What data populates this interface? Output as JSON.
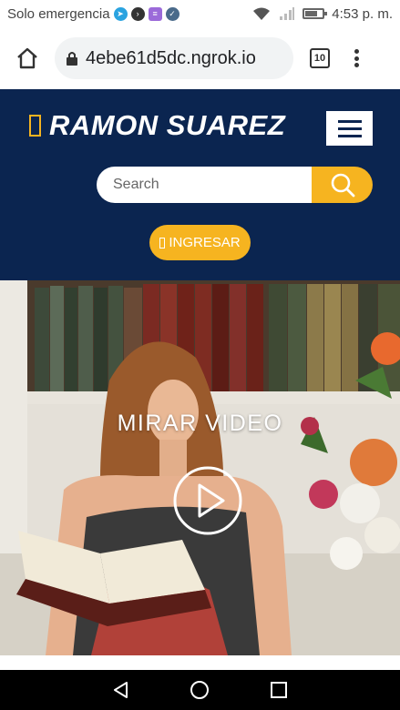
{
  "status_bar": {
    "carrier": "Solo emergencia",
    "time": "4:53 p. m.",
    "battery_level": 0.65,
    "notification_icons": [
      "telegram-icon",
      "terminal-icon",
      "app-icon",
      "check-icon"
    ]
  },
  "browser": {
    "url": "4ebe61d5dc.ngrok.io",
    "tab_count": "10"
  },
  "header": {
    "brand_name": "RAMON SUAREZ",
    "search_placeholder": "Search",
    "login_label": "INGRESAR"
  },
  "hero": {
    "title": "MIRAR VIDEO"
  },
  "colors": {
    "navy": "#0b2550",
    "accent": "#f6b420"
  }
}
